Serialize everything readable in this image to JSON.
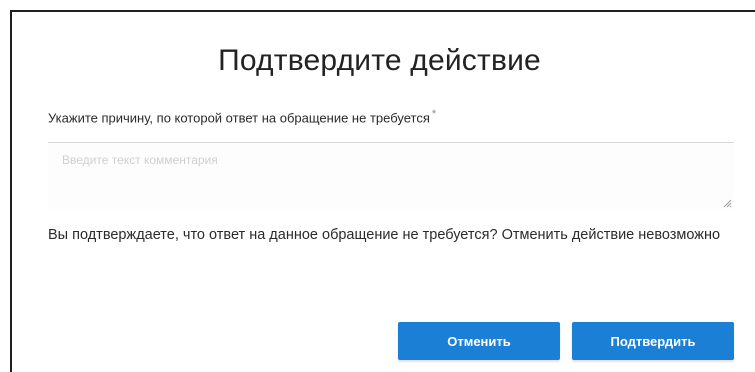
{
  "dialog": {
    "title": "Подтвердите действие",
    "reason_label": "Укажите причину, по которой ответ на обращение не требуется",
    "required_mark": "*",
    "reason_placeholder": "Введите текст комментария",
    "reason_value": "",
    "confirm_message": "Вы подтверждаете, что ответ на данное обращение не требуется? Отменить действие невозможно",
    "cancel_label": "Отменить",
    "confirm_label": "Подтвердить"
  },
  "colors": {
    "accent": "#1b7fd6",
    "text": "#2b2b2b"
  }
}
